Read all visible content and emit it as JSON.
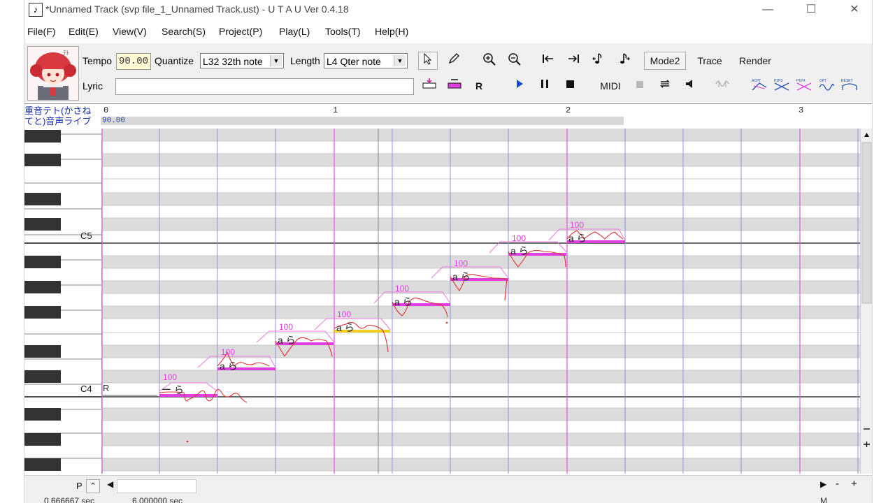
{
  "window": {
    "title": "*Unnamed Track (svp file_1_Unnamed Track.ust) - U T A U Ver 0.4.18",
    "minimize": "—",
    "maximize": "☐",
    "close": "✕"
  },
  "menu": [
    "File(F)",
    "Edit(E)",
    "View(V)",
    "Search(S)",
    "Project(P)",
    "Play(L)",
    "Tools(T)",
    "Help(H)"
  ],
  "toolbar": {
    "tempo_label": "Tempo",
    "tempo_value": "90.00",
    "quantize_label": "Quantize",
    "quantize_value": "L32 32th note",
    "length_label": "Length",
    "length_value": "L4  Qter note",
    "lyric_label": "Lyric",
    "lyric_value": "",
    "mode_label": "Mode2",
    "trace_label": "Trace",
    "render_label": "Render",
    "midi_label": "MIDI",
    "r_label": "R",
    "avatar_text": "ﾃﾄ"
  },
  "ruler": {
    "singer": "重音テト(かさねてと)音声ライブ",
    "tempo": "90.00",
    "measures": [
      "0",
      "1",
      "2",
      "3"
    ]
  },
  "keys": {
    "c5": "C5",
    "c4": "C4"
  },
  "rest_label": "R",
  "notes": [
    {
      "lyric": "ー ら",
      "velocity": "100"
    },
    {
      "lyric": "a ら",
      "velocity": "100"
    },
    {
      "lyric": "a ら",
      "velocity": "100"
    },
    {
      "lyric": "a ら",
      "velocity": "100"
    },
    {
      "lyric": "a ら",
      "velocity": "100"
    },
    {
      "lyric": "a ら",
      "velocity": "100"
    },
    {
      "lyric": "a ら",
      "velocity": "100"
    },
    {
      "lyric": "a ら",
      "velocity": "100"
    }
  ],
  "bottom": {
    "p_label": "P",
    "minus": "-",
    "plus": "+"
  },
  "status": {
    "left": "0.666667 sec",
    "right": "6.000000 sec",
    "far_right": "M"
  },
  "colors": {
    "accent_note": "#e040e0",
    "selected_note": "#f0d020",
    "pitch_line": "#e03030",
    "measure_line": "#e060e0",
    "beat_line": "#8080d0"
  }
}
